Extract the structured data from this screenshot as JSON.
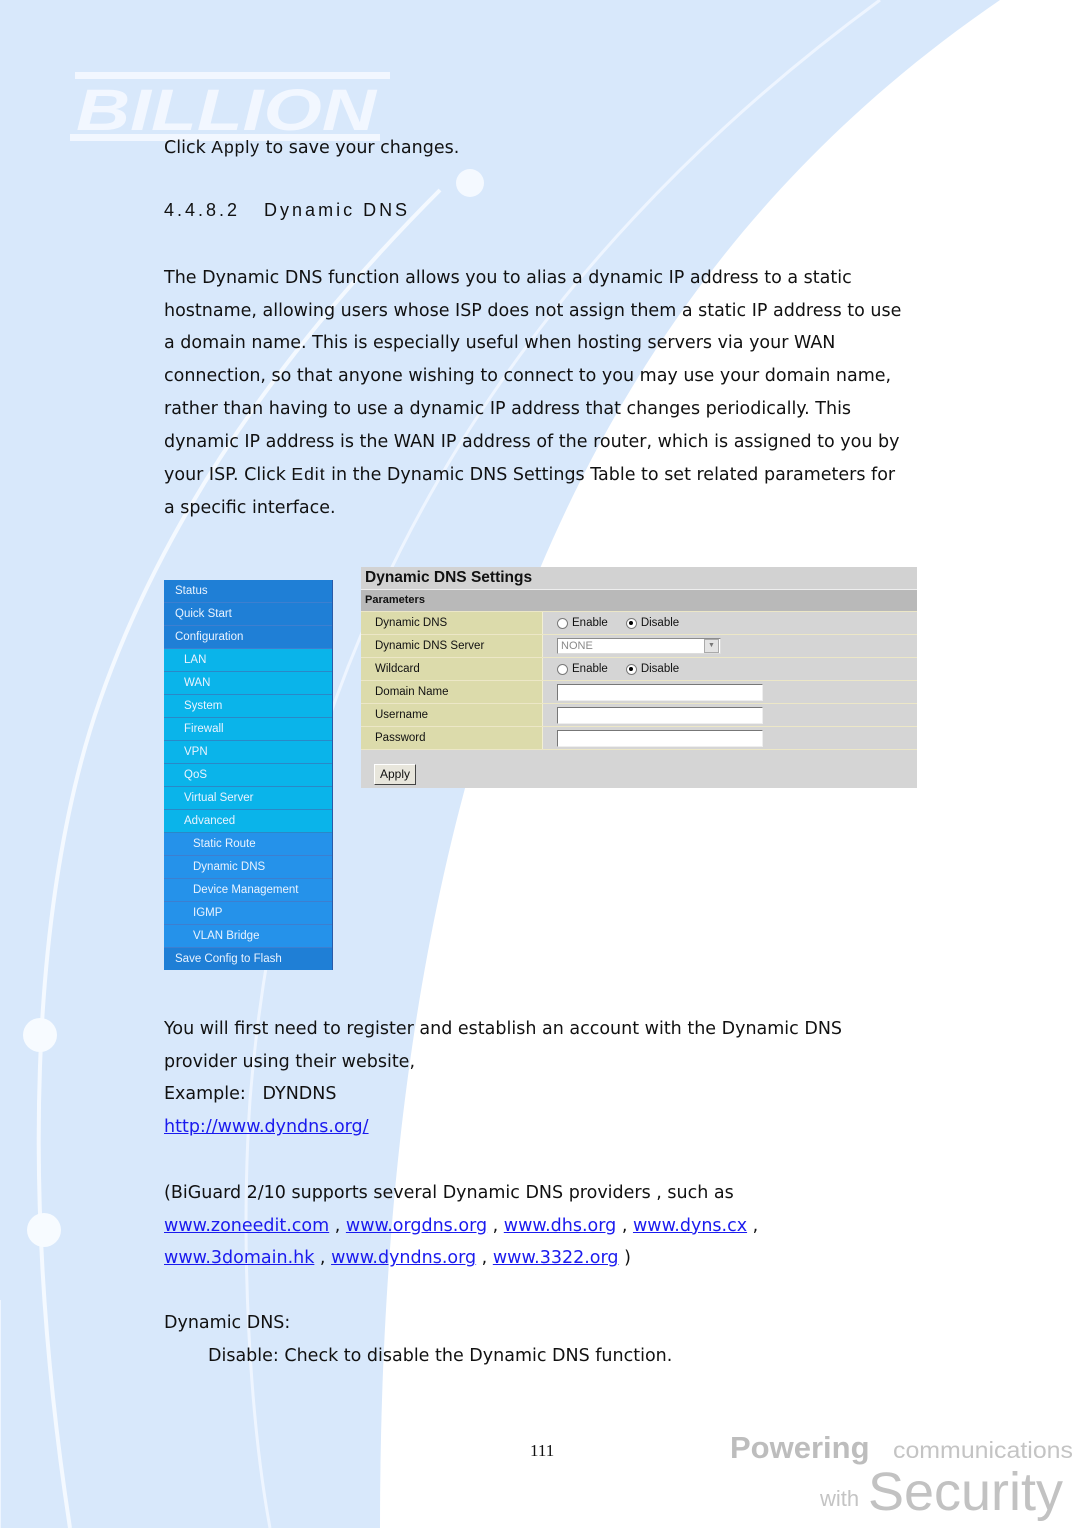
{
  "brand": {
    "logo_text": "BILLION",
    "footer_line1_bold": "Powering",
    "footer_line1_rest": "communications",
    "footer_line2_small": "with",
    "footer_line2_big": "Security"
  },
  "intro_line": {
    "prefix": "Click ",
    "keyword": "Apply",
    "suffix": " to save your changes."
  },
  "section_heading": "4.4.8.2   Dynamic DNS",
  "description": {
    "lines": [
      "The Dynamic DNS function allows you to alias a dynamic IP address to a static",
      "hostname, allowing users whose ISP does not assign them a static IP address to use",
      "a domain name. This is especially useful when hosting servers via your WAN",
      "connection, so that anyone wishing to connect to you may use your domain name,",
      "rather than having to use a dynamic IP address that changes periodically. This",
      "dynamic IP address is the WAN IP address of the router, which is assigned to you by"
    ],
    "line7_prefix": "your ISP. Click ",
    "line7_keyword": "Edit",
    "line7_suffix": " in the Dynamic DNS Settings Table to set related parameters for",
    "line8": "a specific interface."
  },
  "sidebar": {
    "items": [
      {
        "label": "Status",
        "level": 0
      },
      {
        "label": "Quick Start",
        "level": 0
      },
      {
        "label": "Configuration",
        "level": 0
      },
      {
        "label": "LAN",
        "level": 1
      },
      {
        "label": "WAN",
        "level": 1
      },
      {
        "label": "System",
        "level": 1
      },
      {
        "label": "Firewall",
        "level": 1
      },
      {
        "label": "VPN",
        "level": 1
      },
      {
        "label": "QoS",
        "level": 1
      },
      {
        "label": "Virtual Server",
        "level": 1
      },
      {
        "label": "Advanced",
        "level": 1
      },
      {
        "label": "Static Route",
        "level": 2
      },
      {
        "label": "Dynamic DNS",
        "level": 2
      },
      {
        "label": "Device Management",
        "level": 2
      },
      {
        "label": "IGMP",
        "level": 2
      },
      {
        "label": "VLAN Bridge",
        "level": 2
      },
      {
        "label": "Save Config to Flash",
        "level": 0
      }
    ]
  },
  "settings": {
    "title": "Dynamic DNS Settings",
    "section": "Parameters",
    "dynamic_dns": {
      "label": "Dynamic DNS",
      "options": [
        "Enable",
        "Disable"
      ],
      "selected": "Disable"
    },
    "server": {
      "label": "Dynamic DNS Server",
      "value": "NONE"
    },
    "wildcard": {
      "label": "Wildcard",
      "options": [
        "Enable",
        "Disable"
      ],
      "selected": "Disable"
    },
    "domain_name": {
      "label": "Domain Name",
      "value": ""
    },
    "username": {
      "label": "Username",
      "value": ""
    },
    "password": {
      "label": "Password",
      "value": ""
    },
    "apply_label": "Apply"
  },
  "register": {
    "line1": "You will first need to register and establish an account with the Dynamic DNS",
    "line2": "provider using their website,",
    "example": "Example:   DYNDNS",
    "example_link": "http://www.dyndns.org/"
  },
  "providers": {
    "intro": "(BiGuard 2/10 supports several Dynamic DNS providers , such as",
    "links": [
      "www.zoneedit.com",
      "www.orgdns.org",
      "www.dhs.org",
      "www.dyns.cx",
      "www.3domain.hk",
      "www.dyndns.org",
      "www.3322.org"
    ],
    "separator": " , ",
    "closing": " )"
  },
  "field_desc": {
    "title": "Dynamic DNS:",
    "disable": "Disable: Check to disable the Dynamic DNS function."
  },
  "page_number": "111",
  "colors": {
    "bg_blue": "#d8e8fb",
    "nav_top": "#1f7fd6",
    "nav_sub": "#0ab4ea",
    "nav_sub2": "#2592ea",
    "label_cell": "#dcdbab",
    "value_cell": "#d5d5d5",
    "link": "#1a1aee"
  }
}
